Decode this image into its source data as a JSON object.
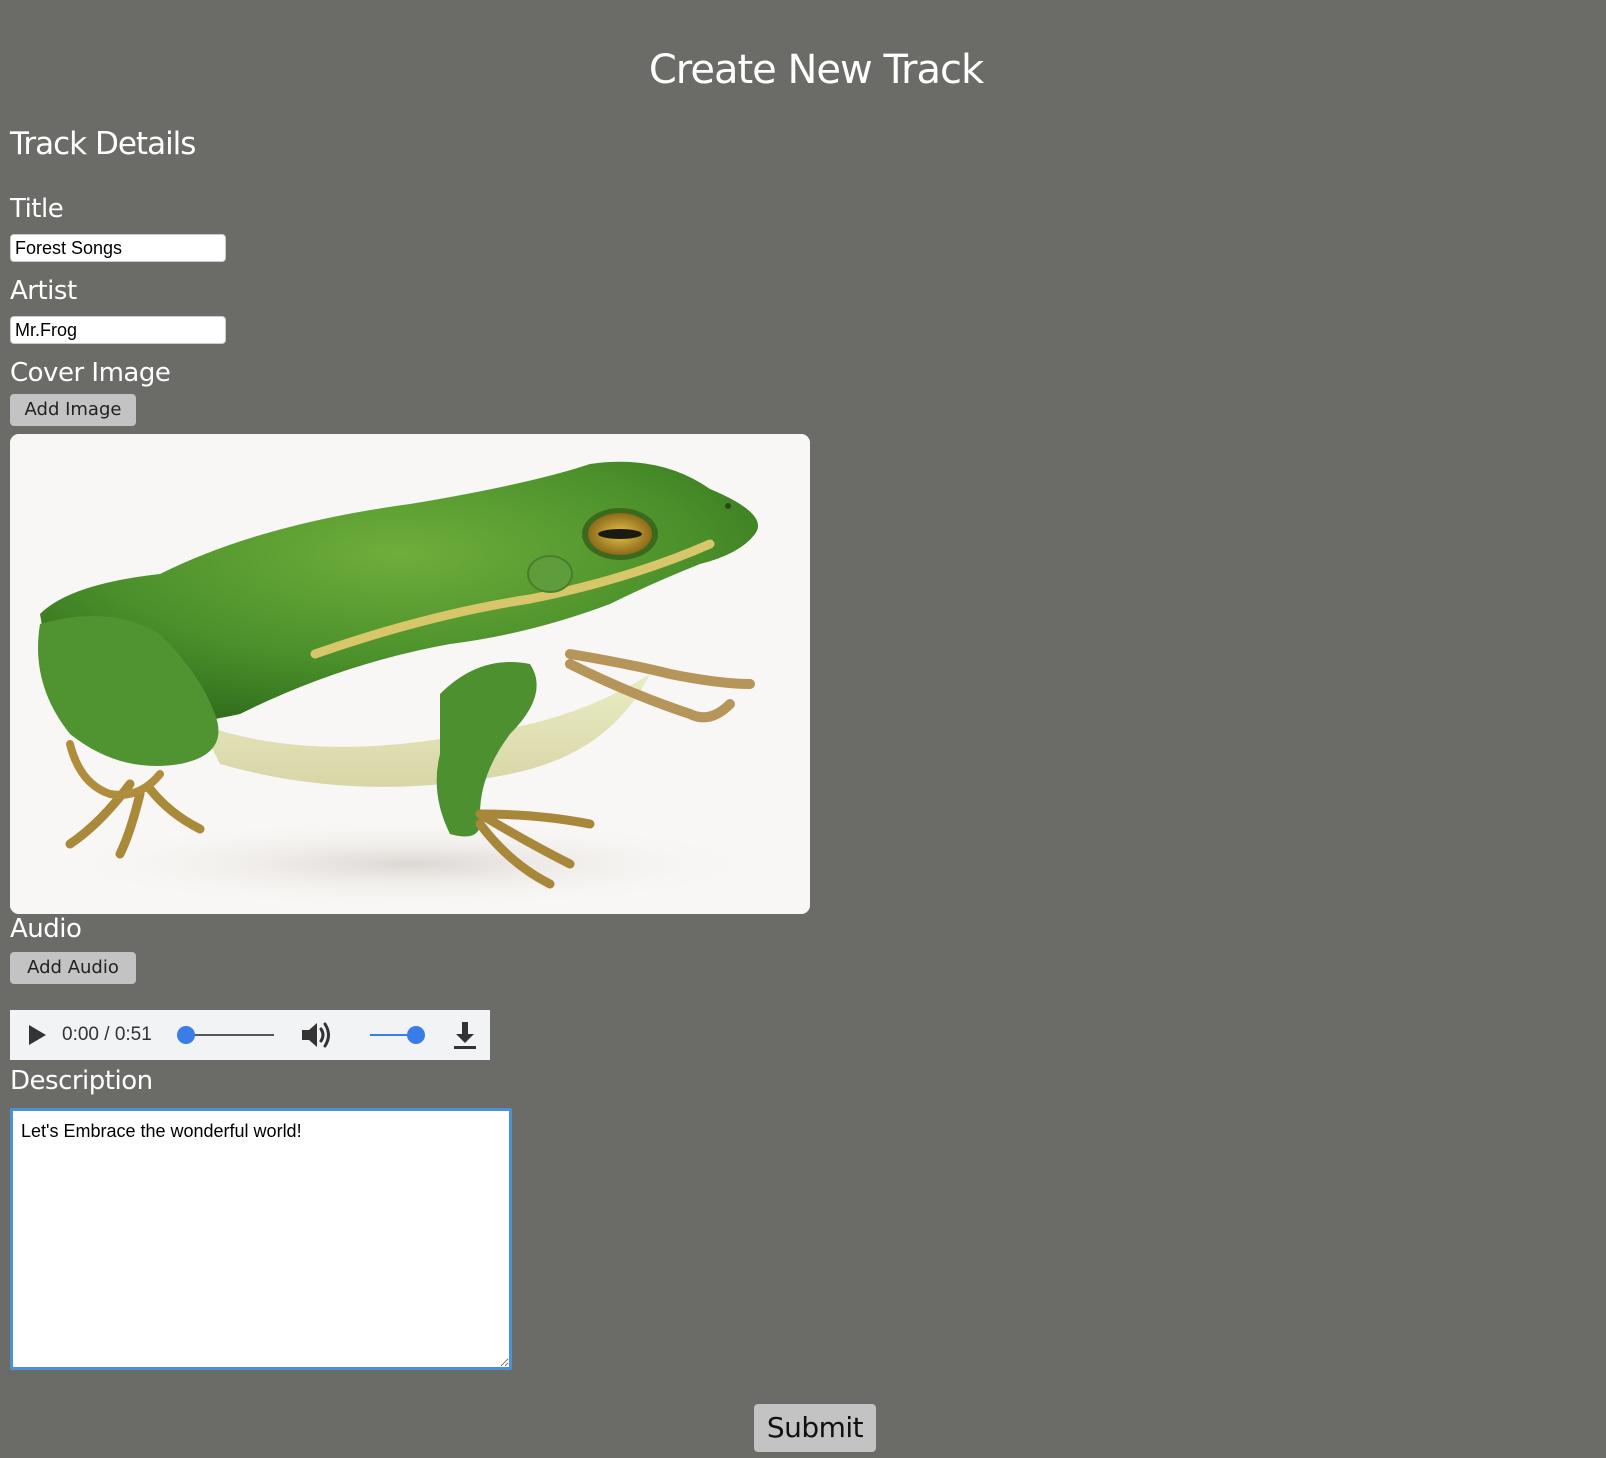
{
  "header": {
    "title": "Create New Track"
  },
  "form": {
    "section_title": "Track Details",
    "title": {
      "label": "Title",
      "value": "Forest Songs"
    },
    "artist": {
      "label": "Artist",
      "value": "Mr.Frog"
    },
    "cover_image": {
      "label": "Cover Image",
      "button_label": "Add Image",
      "image_subject": "green-frog"
    },
    "audio": {
      "label": "Audio",
      "button_label": "Add Audio",
      "player": {
        "time_display": "0:00 / 0:51",
        "current_time": "0:00",
        "duration": "0:51",
        "progress_fraction": 0.0,
        "volume_fraction": 1.0,
        "icons": [
          "play-icon",
          "volume-icon",
          "download-icon"
        ]
      }
    },
    "description": {
      "label": "Description",
      "value": "Let's Embrace the wonderful world!"
    },
    "submit_label": "Submit"
  },
  "colors": {
    "page_background": "#6b6c67",
    "text": "#ffffff",
    "button_background": "#c3c3c3",
    "player_accent": "#3b7de8",
    "focus_border": "#4d90d6"
  }
}
